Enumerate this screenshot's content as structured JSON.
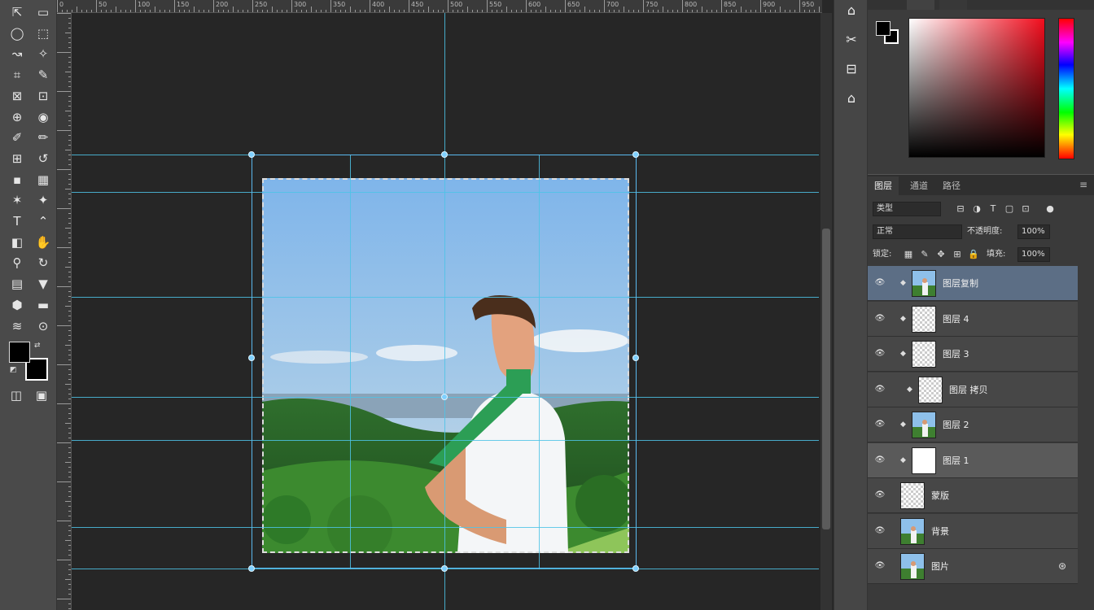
{
  "toolbar": {
    "tools": [
      {
        "icon": "move-tool",
        "glyph": "⇱"
      },
      {
        "icon": "artboard-tool",
        "glyph": "▭"
      },
      {
        "icon": "lasso-tool",
        "glyph": "◯"
      },
      {
        "icon": "marquee-tool",
        "glyph": "⬚"
      },
      {
        "icon": "quick-select-tool",
        "glyph": "↝"
      },
      {
        "icon": "magic-wand-tool",
        "glyph": "✧"
      },
      {
        "icon": "crop-tool",
        "glyph": "⌗"
      },
      {
        "icon": "eyedropper-tool",
        "glyph": "✎"
      },
      {
        "icon": "frame-tool",
        "glyph": "⊠"
      },
      {
        "icon": "patch-tool",
        "glyph": "⊡"
      },
      {
        "icon": "spot-heal-tool",
        "glyph": "⊕"
      },
      {
        "icon": "brush-tool",
        "glyph": "◉"
      },
      {
        "icon": "pen-tool",
        "glyph": "✐"
      },
      {
        "icon": "pencil-tool",
        "glyph": "✏"
      },
      {
        "icon": "stamp-tool",
        "glyph": "⊞"
      },
      {
        "icon": "history-brush-tool",
        "glyph": "↺"
      },
      {
        "icon": "eraser-tool",
        "glyph": "▪"
      },
      {
        "icon": "gradient-tool",
        "glyph": "▦"
      },
      {
        "icon": "blur-tool",
        "glyph": "✶"
      },
      {
        "icon": "dodge-tool",
        "glyph": "✦"
      },
      {
        "icon": "type-tool",
        "glyph": "T"
      },
      {
        "icon": "path-select-tool",
        "glyph": "⌃"
      },
      {
        "icon": "shape-tool",
        "glyph": "◧"
      },
      {
        "icon": "hand-tool",
        "glyph": "✋"
      },
      {
        "icon": "zoom-tool",
        "glyph": "⚲"
      },
      {
        "icon": "rotate-view-tool",
        "glyph": "↻"
      },
      {
        "icon": "note-tool",
        "glyph": "▤"
      },
      {
        "icon": "count-tool",
        "glyph": "▼"
      },
      {
        "icon": "3d-tool",
        "glyph": "⬢"
      },
      {
        "icon": "ruler-tool",
        "glyph": "▬"
      },
      {
        "icon": "smudge-tool",
        "glyph": "≋"
      },
      {
        "icon": "mixer-brush-tool",
        "glyph": "⊙"
      }
    ],
    "foreground_color": "#000000",
    "background_color": "#000000",
    "bottom_icons": [
      {
        "icon": "quick-mask-icon",
        "glyph": "◫"
      },
      {
        "icon": "screen-mode-icon",
        "glyph": "▣"
      }
    ]
  },
  "ruler": {
    "top_labels": [
      "0",
      "50",
      "100",
      "150",
      "200",
      "250",
      "300",
      "350",
      "400",
      "450",
      "500",
      "550",
      "600",
      "650",
      "700",
      "750",
      "800",
      "850",
      "900",
      "950"
    ]
  },
  "minipanel": {
    "buttons": [
      {
        "icon": "history-icon",
        "glyph": "⌂"
      },
      {
        "icon": "brush-settings-icon",
        "glyph": "✂"
      },
      {
        "icon": "clone-source-icon",
        "glyph": "⊟"
      },
      {
        "icon": "properties-icon",
        "glyph": "⌂"
      }
    ]
  },
  "color_panel": {
    "foreground": "#000000",
    "background": "#000000",
    "hue_base": "#f20d1d"
  },
  "layers_panel": {
    "tabs": [
      "图层",
      "通道",
      "路径"
    ],
    "active_tab": 0,
    "filter_kind": "类型",
    "blend_mode": "正常",
    "opacity_label": "不透明度:",
    "opacity_value": "100%",
    "lock_label": "锁定:",
    "fill_label": "填充:",
    "fill_value": "100%",
    "layers": [
      {
        "name": "图层复制",
        "thumb": "photo",
        "selected": true,
        "fx": ""
      },
      {
        "name": "图层 4",
        "thumb": "trans",
        "selected": false,
        "fx": ""
      },
      {
        "name": "图层 3",
        "thumb": "trans",
        "selected": false,
        "fx": ""
      },
      {
        "name": "图层 拷贝",
        "thumb": "trans",
        "selected": false,
        "fx": ""
      },
      {
        "name": "图层 2",
        "thumb": "photo",
        "selected": false,
        "fx": ""
      },
      {
        "name": "图层 1",
        "thumb": "white",
        "selected": false,
        "fx": "",
        "highlight": true
      },
      {
        "name": "蒙版",
        "thumb": "trans",
        "selected": false,
        "fx": ""
      },
      {
        "name": "背景",
        "thumb": "photo",
        "selected": false,
        "fx": ""
      },
      {
        "name": "图片",
        "thumb": "photo",
        "selected": false,
        "fx": "⊛"
      }
    ]
  },
  "colors": {
    "guide": "#4ec3e6",
    "selection": "#5c6e85",
    "panel": "#3c3c3c"
  }
}
